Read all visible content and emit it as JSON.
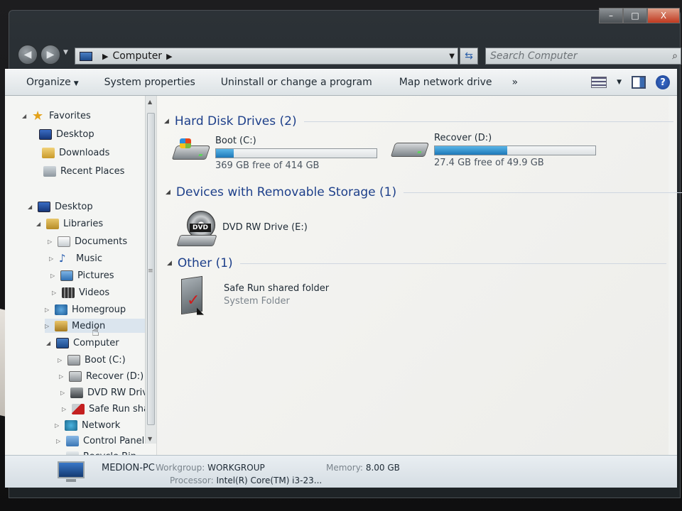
{
  "window": {
    "caption": {
      "minimize": "–",
      "maximize": "□",
      "close": "X"
    }
  },
  "address": {
    "location": "Computer",
    "separator": "▶",
    "search_placeholder": "Search Computer"
  },
  "toolbar": {
    "organize": "Organize",
    "system_properties": "System properties",
    "uninstall": "Uninstall or change a program",
    "map_drive": "Map network drive",
    "more": "»"
  },
  "nav": {
    "favorites": "Favorites",
    "fav_desktop": "Desktop",
    "fav_downloads": "Downloads",
    "fav_recent": "Recent Places",
    "desktop": "Desktop",
    "libraries": "Libraries",
    "documents": "Documents",
    "music": "Music",
    "pictures": "Pictures",
    "videos": "Videos",
    "homegroup": "Homegroup",
    "user": "Medion",
    "computer": "Computer",
    "boot": "Boot (C:)",
    "recover": "Recover (D:)",
    "dvd": "DVD RW Drive (",
    "saferun": "Safe Run share",
    "network": "Network",
    "control_panel": "Control Panel",
    "recycle_bin": "Recycle Bin"
  },
  "groups": {
    "hdd": "Hard Disk Drives (2)",
    "removable": "Devices with Removable Storage (1)",
    "other": "Other (1)"
  },
  "drives": {
    "boot_name": "Boot (C:)",
    "boot_free": "369 GB free of 414 GB",
    "boot_used_fraction": 0.11,
    "recover_name": "Recover (D:)",
    "recover_free": "27.4 GB free of 49.9 GB",
    "recover_used_fraction": 0.45,
    "dvd_name": "DVD RW Drive (E:)",
    "dvd_badge": "DVD",
    "saferun_name": "Safe Run shared folder",
    "saferun_type": "System Folder"
  },
  "details": {
    "pc_name": "MEDION-PC",
    "workgroup_label": "Workgroup:",
    "workgroup_value": "WORKGROUP",
    "memory_label": "Memory:",
    "memory_value": "8.00 GB",
    "processor_label": "Processor:",
    "processor_value": "Intel(R) Core(TM) i3-23..."
  },
  "colors": {
    "header_blue": "#1d3f8a",
    "bar_fill": "#1e78b8"
  }
}
